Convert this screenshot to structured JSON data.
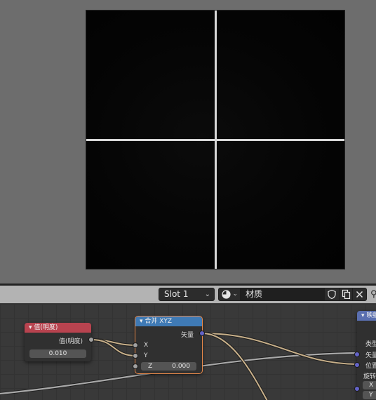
{
  "header": {
    "slot": "Slot 1",
    "slot_chevron": "⌄",
    "material_name": "材质"
  },
  "nodes": {
    "value": {
      "title": "值(明度)",
      "output_label": "值(明度)",
      "value": "0.010",
      "color": "#b8434f"
    },
    "combine_xyz": {
      "title": "合并 XYZ",
      "output_label": "矢量",
      "input_x": "X",
      "input_y": "Y",
      "input_z_label": "Z",
      "input_z_value": "0.000",
      "color": "#3f7ab5"
    },
    "mapping": {
      "title": "映射",
      "type_label": "类型",
      "input_vector": "矢量",
      "input_location": "位置",
      "rotation_label": "旋转",
      "x_label": "X",
      "y_label": "Y",
      "color": "#5a6fb0"
    }
  },
  "colors": {
    "wire_float": "#c8b08a",
    "wire_grey": "#a8a8a8",
    "image_line": "#d8d8d8"
  }
}
